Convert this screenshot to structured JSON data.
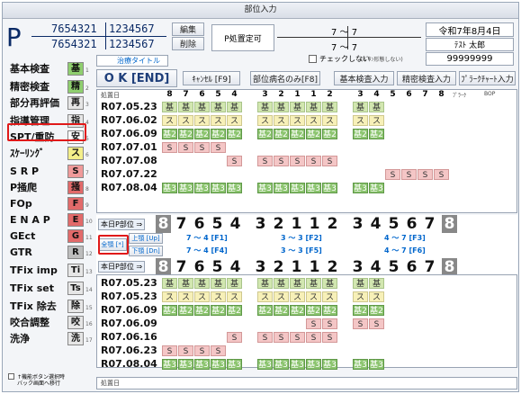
{
  "window": {
    "title": "部位入力"
  },
  "header": {
    "p_letter": "P",
    "num_top_a": "7654321",
    "num_top_b": "1234567",
    "num_bot_a": "7654321",
    "num_bot_b": "1234567",
    "btn_edit": "編集",
    "btn_delete": "削除",
    "p_judgement": "P処置定可",
    "arch_top": "7 ～ 7",
    "arch_bot": "7 ～ 7",
    "date": "令和7年8月4日",
    "patient": "ﾃｽﾄ 太郎",
    "patient_id": "99999999",
    "chk_label": "チェックしない",
    "chk_hint": "(ﾎﾞﾀﾝ形態しない)"
  },
  "left_menu": [
    {
      "label": "基本検査",
      "badge": "基",
      "color": "#8fcf6f"
    },
    {
      "label": "精密検査",
      "badge": "精",
      "color": "#8fcf6f"
    },
    {
      "label": "部分再評価",
      "badge": "再",
      "color": "#e6e6e6"
    },
    {
      "label": "指導管理",
      "badge": "指",
      "color": "#e6e6e6"
    },
    {
      "label": "SPT/重防",
      "badge": "安",
      "color": "#ffffff"
    },
    {
      "label": "ｽｹｰﾘﾝｸﾞ",
      "badge": "ス",
      "color": "#f4ef8a"
    },
    {
      "label": "S R P",
      "badge": "S",
      "color": "#f09a9a"
    },
    {
      "label": "P掻爬",
      "badge": "掻",
      "color": "#e26a6a"
    },
    {
      "label": "FOp",
      "badge": "F",
      "color": "#e26a6a"
    },
    {
      "label": "E N A P",
      "badge": "E",
      "color": "#e26a6a"
    },
    {
      "label": "GEct",
      "badge": "G",
      "color": "#e26a6a"
    },
    {
      "label": "GTR",
      "badge": "R",
      "color": "#bdbdbd"
    },
    {
      "label": "TFix imp",
      "badge": "Ti",
      "color": "#e6e6e6"
    },
    {
      "label": "TFix set",
      "badge": "Ts",
      "color": "#e6e6e6"
    },
    {
      "label": "TFix 除去",
      "badge": "除",
      "color": "#e6e6e6"
    },
    {
      "label": "咬合調整",
      "badge": "咬",
      "color": "#e6e6e6"
    },
    {
      "label": "洗浄",
      "badge": "洗",
      "color": "#e6e6e6"
    }
  ],
  "left_nums": [
    "1",
    "2",
    "3",
    "4",
    "5",
    "6",
    "7",
    "8",
    "9",
    "10",
    "11",
    "12",
    "13",
    "14",
    "15",
    "16",
    "17"
  ],
  "footer": {
    "check_label": "↑機能ボタン選択時",
    "check_sub": "バック画面へ移行"
  },
  "toolbar": {
    "tab_title": "治療タイトル",
    "ok": "O K [END]",
    "cancel": "ｷｬﾝｾﾙ [F9]",
    "load_name": "部位病名のみ[F8]",
    "basic_input": "基本検査入力",
    "detail_input": "精密検査入力",
    "chart_input": "ﾌﾟﾗｰｸﾁｬｰﾄ入力"
  },
  "top_table": {
    "header_date": "処置日",
    "teeth": [
      "8",
      "7",
      "6",
      "5",
      "4",
      "3",
      "2",
      "1",
      "1",
      "2",
      "3",
      "4",
      "5",
      "6",
      "7",
      "8"
    ],
    "plaque": "ﾌﾟﾗｰｸ",
    "bop": "BOP",
    "rows": [
      {
        "date": "R07.05.23",
        "cells": [
          "基",
          "基",
          "基",
          "基",
          "基",
          "基",
          "基",
          "基",
          "基",
          "基",
          "基",
          "基"
        ],
        "start": 0,
        "type": "g"
      },
      {
        "date": "R07.06.02",
        "cells": [
          "ス",
          "ス",
          "ス",
          "ス",
          "ス",
          "ス",
          "ス",
          "ス",
          "ス",
          "ス",
          "ス",
          "ス"
        ],
        "start": 0,
        "type": "y"
      },
      {
        "date": "R07.06.09",
        "cells": [
          "基2",
          "基2",
          "基2",
          "基2",
          "基2",
          "基2",
          "基2",
          "基2",
          "基2",
          "基2",
          "基2",
          "基2"
        ],
        "start": 0,
        "type": "gr"
      },
      {
        "date": "R07.07.01",
        "cells": [
          "S",
          "S",
          "S",
          "S"
        ],
        "start": 0,
        "type": "p"
      },
      {
        "date": "R07.07.08",
        "cells": [
          "S",
          "S",
          "S",
          "S",
          "S",
          "S"
        ],
        "start": 4,
        "type": "p"
      },
      {
        "date": "R07.07.22",
        "cells": [
          "S",
          "S",
          "S",
          "S"
        ],
        "start": 12,
        "type": "p"
      },
      {
        "date": "R07.08.04",
        "cells": [
          "基3",
          "基3",
          "基3",
          "基3",
          "基3",
          "基3",
          "基3",
          "基3",
          "基3",
          "基3",
          "基3",
          "基3"
        ],
        "start": 0,
        "type": "gr"
      }
    ]
  },
  "today_part": {
    "label": "本日P部位 ⇒",
    "teeth": [
      "8",
      "7",
      "6",
      "5",
      "4",
      "3",
      "2",
      "1",
      "1",
      "2",
      "3",
      "4",
      "5",
      "6",
      "7",
      "8"
    ]
  },
  "range": {
    "all": "全顎 [*]",
    "upper": "上顎 [Up]",
    "lower": "下顎 [Dn]",
    "u1": "7 ～ 4 [F1]",
    "u2": "3 ～ 3 [F2]",
    "u3": "4 ～ 7 [F3]",
    "l1": "7 ～ 4 [F4]",
    "l2": "3 ～ 3 [F5]",
    "l3": "4 ～ 7 [F6]"
  },
  "today_part2": {
    "label": "本日P部位 ⇒",
    "teeth": [
      "8",
      "7",
      "6",
      "5",
      "4",
      "3",
      "2",
      "1",
      "1",
      "2",
      "3",
      "4",
      "5",
      "6",
      "7",
      "8"
    ]
  },
  "bottom_table": {
    "rows": [
      {
        "date": "R07.05.23",
        "cells": [
          "基",
          "基",
          "基",
          "基",
          "基",
          "基",
          "基",
          "基",
          "基",
          "基",
          "基",
          "基"
        ],
        "start": 0,
        "type": "g"
      },
      {
        "date": "R07.05.23",
        "cells": [
          "ス",
          "ス",
          "ス",
          "ス",
          "ス",
          "ス",
          "ス",
          "ス",
          "ス",
          "ス",
          "ス",
          "ス"
        ],
        "start": 0,
        "type": "y"
      },
      {
        "date": "R07.06.09",
        "cells": [
          "基2",
          "基2",
          "基2",
          "基2",
          "基2",
          "基2",
          "基2",
          "基2",
          "基2",
          "基2",
          "基2",
          "基2"
        ],
        "start": 0,
        "type": "gr"
      },
      {
        "date": "R07.06.09",
        "cells": [
          "S",
          "S",
          "S",
          "S"
        ],
        "start": 8,
        "type": "p"
      },
      {
        "date": "R07.06.16",
        "cells": [
          "S",
          "S",
          "S",
          "S",
          "S",
          "S"
        ],
        "start": 4,
        "type": "p"
      },
      {
        "date": "R07.06.23",
        "cells": [
          "S",
          "S",
          "S",
          "S"
        ],
        "start": 0,
        "type": "p"
      },
      {
        "date": "R07.08.04",
        "cells": [
          "基3",
          "基3",
          "基3",
          "基3",
          "基3",
          "基3",
          "基3",
          "基3",
          "基3",
          "基3",
          "基3",
          "基3"
        ],
        "start": 0,
        "type": "gr"
      }
    ],
    "header_date": "処置日"
  }
}
